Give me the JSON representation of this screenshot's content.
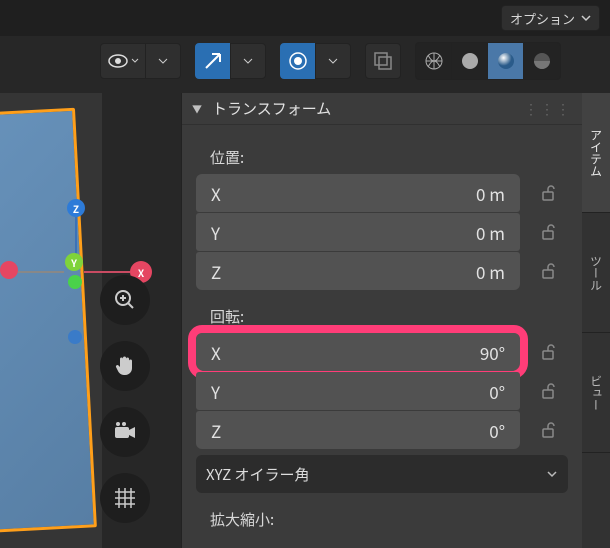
{
  "header": {
    "options_label": "オプション"
  },
  "tabs": {
    "item": "アイテム",
    "tool": "ツール",
    "view": "ビュー"
  },
  "panel": {
    "title": "トランスフォーム",
    "location_label": "位置:",
    "rotation_label": "回転:",
    "scale_label": "拡大縮小:",
    "location": {
      "x_label": "X",
      "x_val": "0 m",
      "y_label": "Y",
      "y_val": "0 m",
      "z_label": "Z",
      "z_val": "0 m"
    },
    "rotation": {
      "x_label": "X",
      "x_val": "90°",
      "y_label": "Y",
      "y_val": "0°",
      "z_label": "Z",
      "z_val": "0°"
    },
    "rotation_mode": "XYZ オイラー角"
  },
  "gizmo": {
    "z": "Z",
    "y": "Y",
    "x": "X"
  }
}
